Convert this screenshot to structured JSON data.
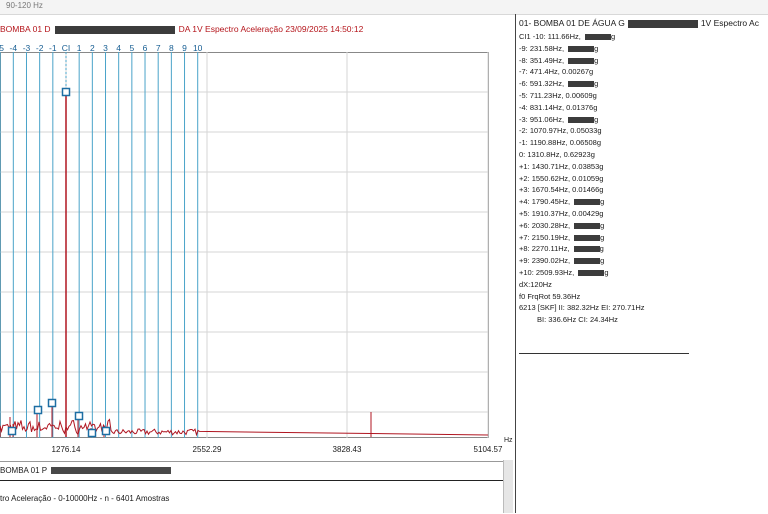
{
  "topstrip": {
    "text": "90-120 Hz"
  },
  "plot": {
    "title_prefix": "BOMBA 01 D",
    "title_suffix": "DA 1V Espectro Aceleração 23/09/2025 14:50:12",
    "harmonic_labels": [
      "-5",
      "-4",
      "-3",
      "-2",
      "-1",
      "CI",
      "1",
      "2",
      "3",
      "4",
      "5",
      "6",
      "7",
      "8",
      "9",
      "10"
    ],
    "x_unit": "Hz",
    "x_ticks": [
      "1276.14",
      "2552.29",
      "3828.43",
      "5104.57"
    ],
    "colors": {
      "trace": "#b01621",
      "harmonic_line": "#4aa3c9",
      "grid": "#d6d6d6",
      "marker": "#1d6ea3"
    }
  },
  "bottom": {
    "row1_prefix": "BOMBA 01 P",
    "row2_text": "tro Aceleração - 0-10000Hz - n - 6401 Amostras"
  },
  "cursor_panel": {
    "title_prefix": "01- BOMBA 01 DE ÁGUA G",
    "title_suffix": "1V Espectro Ac",
    "rows": [
      {
        "text": "CI1 -10: 111.66Hz, ",
        "masked": true,
        "suffix": "g"
      },
      {
        "text": "-9: 231.58Hz, ",
        "masked": true,
        "suffix": "g"
      },
      {
        "text": "-8: 351.49Hz, ",
        "masked": true,
        "suffix": "g"
      },
      {
        "text": "-7: 471.4Hz, 0.00267g",
        "masked": false,
        "suffix": ""
      },
      {
        "text": "-6: 591.32Hz, ",
        "masked": true,
        "suffix": "g"
      },
      {
        "text": "-5: 711.23Hz, 0.00609g",
        "masked": false,
        "suffix": ""
      },
      {
        "text": "-4: 831.14Hz, 0.01376g",
        "masked": false,
        "suffix": ""
      },
      {
        "text": "-3: 951.06Hz, ",
        "masked": true,
        "suffix": "g"
      },
      {
        "text": "-2: 1070.97Hz, 0.05033g",
        "masked": false,
        "suffix": ""
      },
      {
        "text": "-1: 1190.88Hz, 0.06508g",
        "masked": false,
        "suffix": ""
      },
      {
        "text": "0: 1310.8Hz, 0.62923g",
        "masked": false,
        "suffix": ""
      },
      {
        "text": "+1: 1430.71Hz, 0.03853g",
        "masked": false,
        "suffix": ""
      },
      {
        "text": "+2: 1550.62Hz, 0.01059g",
        "masked": false,
        "suffix": ""
      },
      {
        "text": "+3: 1670.54Hz, 0.01466g",
        "masked": false,
        "suffix": ""
      },
      {
        "text": "+4: 1790.45Hz, ",
        "masked": true,
        "suffix": "g"
      },
      {
        "text": "+5: 1910.37Hz, 0.00429g",
        "masked": false,
        "suffix": ""
      },
      {
        "text": "+6: 2030.28Hz, ",
        "masked": true,
        "suffix": "g"
      },
      {
        "text": "+7: 2150.19Hz, ",
        "masked": true,
        "suffix": "g"
      },
      {
        "text": "+8: 2270.11Hz, ",
        "masked": true,
        "suffix": "g"
      },
      {
        "text": "+9: 2390.02Hz, ",
        "masked": true,
        "suffix": "g"
      },
      {
        "text": "+10: 2509.93Hz, ",
        "masked": true,
        "suffix": "g"
      },
      {
        "text": "dX:120Hz",
        "masked": false,
        "suffix": ""
      },
      {
        "text": "f0 FrqRot 59.36Hz",
        "masked": false,
        "suffix": ""
      },
      {
        "text": "6213 [SKF] II: 382.32Hz EI: 270.71Hz",
        "masked": false,
        "suffix": ""
      },
      {
        "text": "BI: 336.6Hz CI: 24.34Hz",
        "masked": false,
        "suffix": ""
      }
    ]
  }
}
